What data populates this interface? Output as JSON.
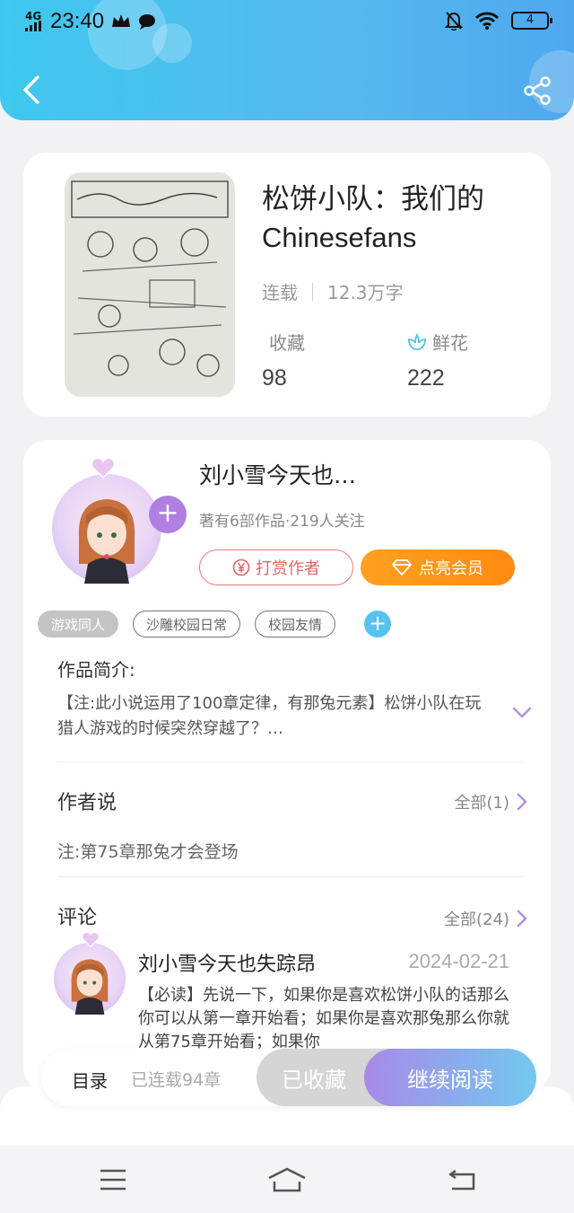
{
  "status_bar": {
    "network": "4G",
    "time": "23:40",
    "battery": "4"
  },
  "book": {
    "title": "松饼小队：我们的Chinesefans",
    "status": "连载",
    "word_count": "12.3万字",
    "favorites_label": "收藏",
    "favorites_value": "98",
    "flowers_label": "鲜花",
    "flowers_value": "222"
  },
  "author": {
    "name": "刘小雪今天也…",
    "sub": "著有6部作品·219人关注",
    "tip_button": "打赏作者",
    "vip_button": "点亮会员",
    "follow_symbol": "+"
  },
  "tags": [
    "游戏同人",
    "沙雕校园日常",
    "校园友情"
  ],
  "tag_add": "+",
  "summary": {
    "title": "作品简介:",
    "text": "【注:此小说运用了100章定律，有那兔元素】松饼小队在玩猎人游戏的时候突然穿越了？…"
  },
  "author_says": {
    "title": "作者说",
    "more": "全部(1)",
    "text": "注:第75章那兔才会登场"
  },
  "comments": {
    "title": "评论",
    "more": "全部(24)",
    "items": [
      {
        "user": "刘小雪今天也失踪昂",
        "date": "2024-02-21",
        "text": "【必读】先说一下，如果你是喜欢松饼小队的话那么你可以从第一章开始看；如果你是喜欢那兔那么你就从第75章开始看；如果你"
      }
    ]
  },
  "action_bar": {
    "toc": "目录",
    "chapter_count": "已连载94章",
    "collected": "已收藏",
    "continue_read": "继续阅读"
  },
  "colors": {
    "header_start": "#3fc8ef",
    "header_end": "#4fa8ee",
    "vip_orange": "#ff8a10",
    "tip_red": "#e56565",
    "read_gradient_start": "#a78ae8",
    "read_gradient_end": "#73c8f0"
  }
}
